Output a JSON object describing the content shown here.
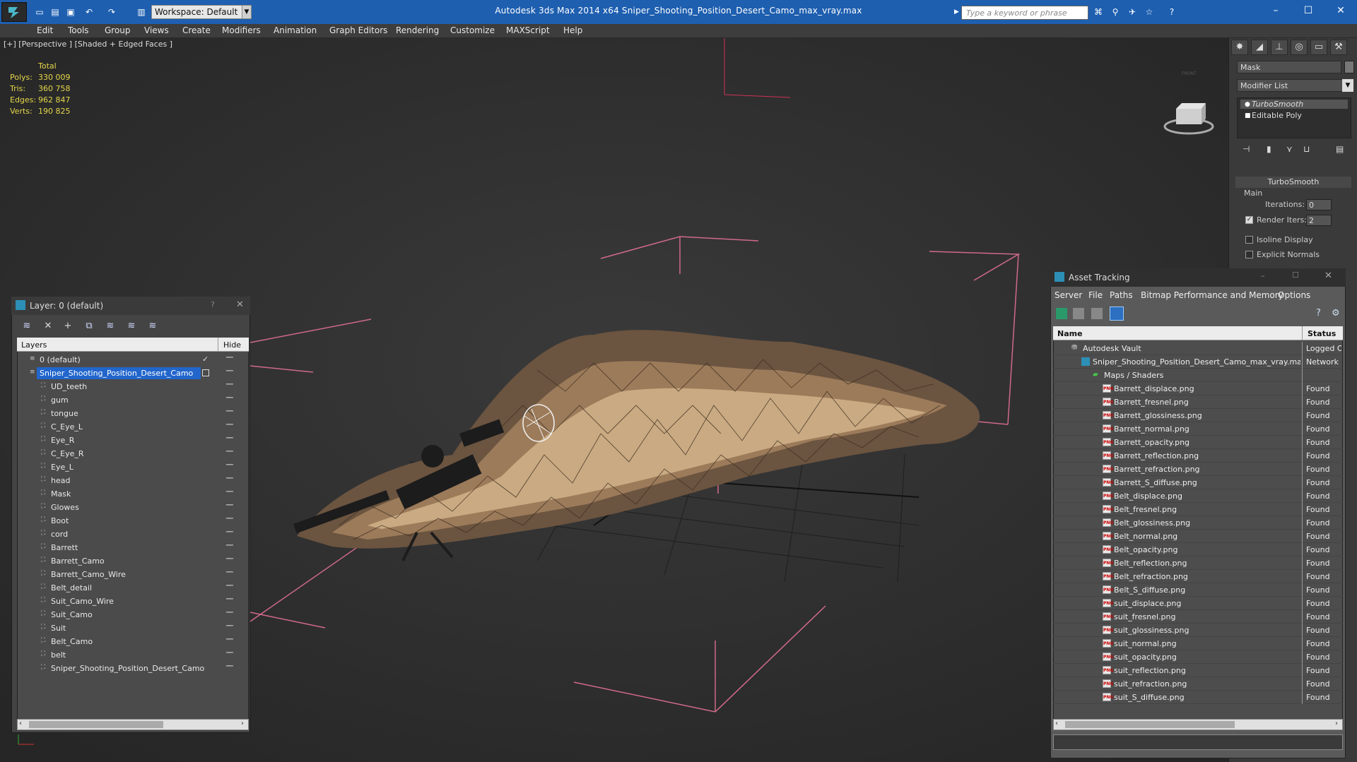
{
  "titlebar": {
    "title": "Autodesk 3ds Max  2014 x64     Sniper_Shooting_Position_Desert_Camo_max_vray.max",
    "workspace": "Workspace: Default",
    "search_placeholder": "Type a keyword or phrase",
    "accent_color": "#1e5fb0"
  },
  "menu": [
    "Edit",
    "Tools",
    "Group",
    "Views",
    "Create",
    "Modifiers",
    "Animation",
    "Graph Editors",
    "Rendering",
    "Customize",
    "MAXScript",
    "Help"
  ],
  "viewport": {
    "label": "[+] [Perspective ] [Shaded + Edged Faces ]",
    "stats_header": "Total",
    "stats": [
      {
        "k": "Polys:",
        "v": "330 009"
      },
      {
        "k": "Tris:",
        "v": "360 758"
      },
      {
        "k": "Edges:",
        "v": "962 847"
      },
      {
        "k": "Verts:",
        "v": "190 825"
      }
    ],
    "viewcube_label": "FRONT"
  },
  "cmdpanel": {
    "object_name": "Mask",
    "modifier_list": "Modifier List",
    "stack": [
      "TurboSmooth",
      "Editable Poly"
    ],
    "rollout": "TurboSmooth",
    "group": "Main",
    "iterations_label": "Iterations:",
    "iterations": "0",
    "render_iters_label": "Render Iters:",
    "render_iters": "2",
    "isoline": "Isoline Display",
    "explicit": "Explicit Normals"
  },
  "layers": {
    "title": "Layer: 0 (default)",
    "col_layers": "Layers",
    "col_hide": "Hide",
    "rows": [
      "0 (default)",
      "Sniper_Shooting_Position_Desert_Camo",
      "UD_teeth",
      "gum",
      "tongue",
      "C_Eye_L",
      "Eye_R",
      "C_Eye_R",
      "Eye_L",
      "head",
      "Mask",
      "Glowes",
      "Boot",
      "cord",
      "Barrett",
      "Barrett_Camo",
      "Barrett_Camo_Wire",
      "Belt_detail",
      "Suit_Camo_Wire",
      "Suit_Camo",
      "Suit",
      "Belt_Camo",
      "belt",
      "Sniper_Shooting_Position_Desert_Camo"
    ]
  },
  "asset": {
    "title": "Asset Tracking",
    "menu": [
      "Server",
      "File",
      "Paths",
      "Bitmap Performance and Memory",
      "Options"
    ],
    "col_name": "Name",
    "col_status": "Status",
    "vault": {
      "name": "Autodesk Vault",
      "status": "Logged O"
    },
    "file": {
      "name": "Sniper_Shooting_Position_Desert_Camo_max_vray.max",
      "status": "Network F"
    },
    "folder": "Maps / Shaders",
    "maps": [
      {
        "name": "Barrett_displace.png",
        "status": "Found"
      },
      {
        "name": "Barrett_fresnel.png",
        "status": "Found"
      },
      {
        "name": "Barrett_glossiness.png",
        "status": "Found"
      },
      {
        "name": "Barrett_normal.png",
        "status": "Found"
      },
      {
        "name": "Barrett_opacity.png",
        "status": "Found"
      },
      {
        "name": "Barrett_reflection.png",
        "status": "Found"
      },
      {
        "name": "Barrett_refraction.png",
        "status": "Found"
      },
      {
        "name": "Barrett_S_diffuse.png",
        "status": "Found"
      },
      {
        "name": "Belt_displace.png",
        "status": "Found"
      },
      {
        "name": "Belt_fresnel.png",
        "status": "Found"
      },
      {
        "name": "Belt_glossiness.png",
        "status": "Found"
      },
      {
        "name": "Belt_normal.png",
        "status": "Found"
      },
      {
        "name": "Belt_opacity.png",
        "status": "Found"
      },
      {
        "name": "Belt_reflection.png",
        "status": "Found"
      },
      {
        "name": "Belt_refraction.png",
        "status": "Found"
      },
      {
        "name": "Belt_S_diffuse.png",
        "status": "Found"
      },
      {
        "name": "suit_displace.png",
        "status": "Found"
      },
      {
        "name": "suit_fresnel.png",
        "status": "Found"
      },
      {
        "name": "suit_glossiness.png",
        "status": "Found"
      },
      {
        "name": "suit_normal.png",
        "status": "Found"
      },
      {
        "name": "suit_opacity.png",
        "status": "Found"
      },
      {
        "name": "suit_reflection.png",
        "status": "Found"
      },
      {
        "name": "suit_refraction.png",
        "status": "Found"
      },
      {
        "name": "suit_S_diffuse.png",
        "status": "Found"
      }
    ]
  }
}
